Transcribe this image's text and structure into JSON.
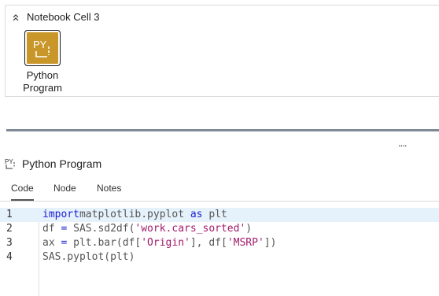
{
  "cell": {
    "title": "Notebook Cell 3"
  },
  "node": {
    "icon_text": "PY",
    "label_line1": "Python",
    "label_line2": "Program"
  },
  "properties": {
    "title": "Python Program",
    "tabs": [
      {
        "label": "Code"
      },
      {
        "label": "Node"
      },
      {
        "label": "Notes"
      }
    ],
    "active_tab": "Code"
  },
  "splitter": {
    "grip": "...."
  },
  "editor": {
    "lines": [
      {
        "number": "1",
        "tokens": [
          [
            "kw",
            "import"
          ],
          [
            "",
            "matplotlib.pyplot "
          ],
          [
            "kw",
            "as"
          ],
          [
            "",
            " plt"
          ]
        ]
      },
      {
        "number": "2",
        "tokens": [
          [
            "",
            "df "
          ],
          [
            "op",
            "="
          ],
          [
            "",
            " SAS.sd2df("
          ],
          [
            "str",
            "'work.cars_sorted'"
          ],
          [
            "",
            ")"
          ]
        ]
      },
      {
        "number": "3",
        "tokens": [
          [
            "",
            "ax "
          ],
          [
            "op",
            "="
          ],
          [
            "",
            " plt.bar(df["
          ],
          [
            "str",
            "'Origin'"
          ],
          [
            "",
            "], df["
          ],
          [
            "str",
            "'MSRP'"
          ],
          [
            "",
            "])"
          ]
        ]
      },
      {
        "number": "4",
        "tokens": [
          [
            "",
            "SAS.pyplot(plt)"
          ]
        ]
      }
    ],
    "highlighted_line": "1"
  },
  "colors": {
    "node_icon": "#c9962a",
    "keyword": "#1b1bd1",
    "string": "#a11a6a",
    "line_highlight": "#e6f2fb",
    "splitter": "#7f8a96"
  }
}
